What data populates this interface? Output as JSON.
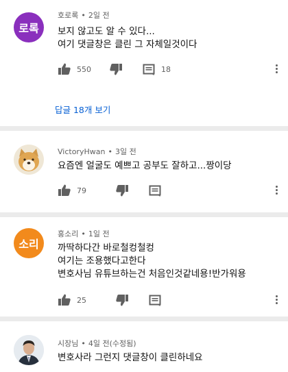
{
  "comments": [
    {
      "avatar_text": "로록",
      "avatar_color": "#8a2fbd",
      "author": "호로록",
      "time": "2일 전",
      "lines": [
        "보지 않고도 알 수 있다...",
        "여기 댓글창은 클린 그 자체일것이다"
      ],
      "likes": "550",
      "reply_count": "18",
      "view_replies": "답글 18개 보기"
    },
    {
      "avatar_kind": "shiba-dog-photo",
      "author": "VictoryHwan",
      "time": "3일 전",
      "lines": [
        "요즘엔 얼굴도 예쁘고 공부도 잘하고...짱이당"
      ],
      "likes": "79"
    },
    {
      "avatar_text": "소리",
      "avatar_color": "#f28a1c",
      "author": "홍소리",
      "time": "1일 전",
      "lines": [
        "까딱하다간 바로철컹철컹",
        "여기는 조용했다고한다",
        "변호사님 유튜브하는건 처음인것같네용!반가워용"
      ],
      "likes": "25"
    },
    {
      "avatar_kind": "man-in-suit-photo",
      "author": "시장님",
      "time": "4일 전(수정됨)",
      "lines": [
        "변호사라 그런지 댓글창이 클린하네요"
      ]
    }
  ]
}
